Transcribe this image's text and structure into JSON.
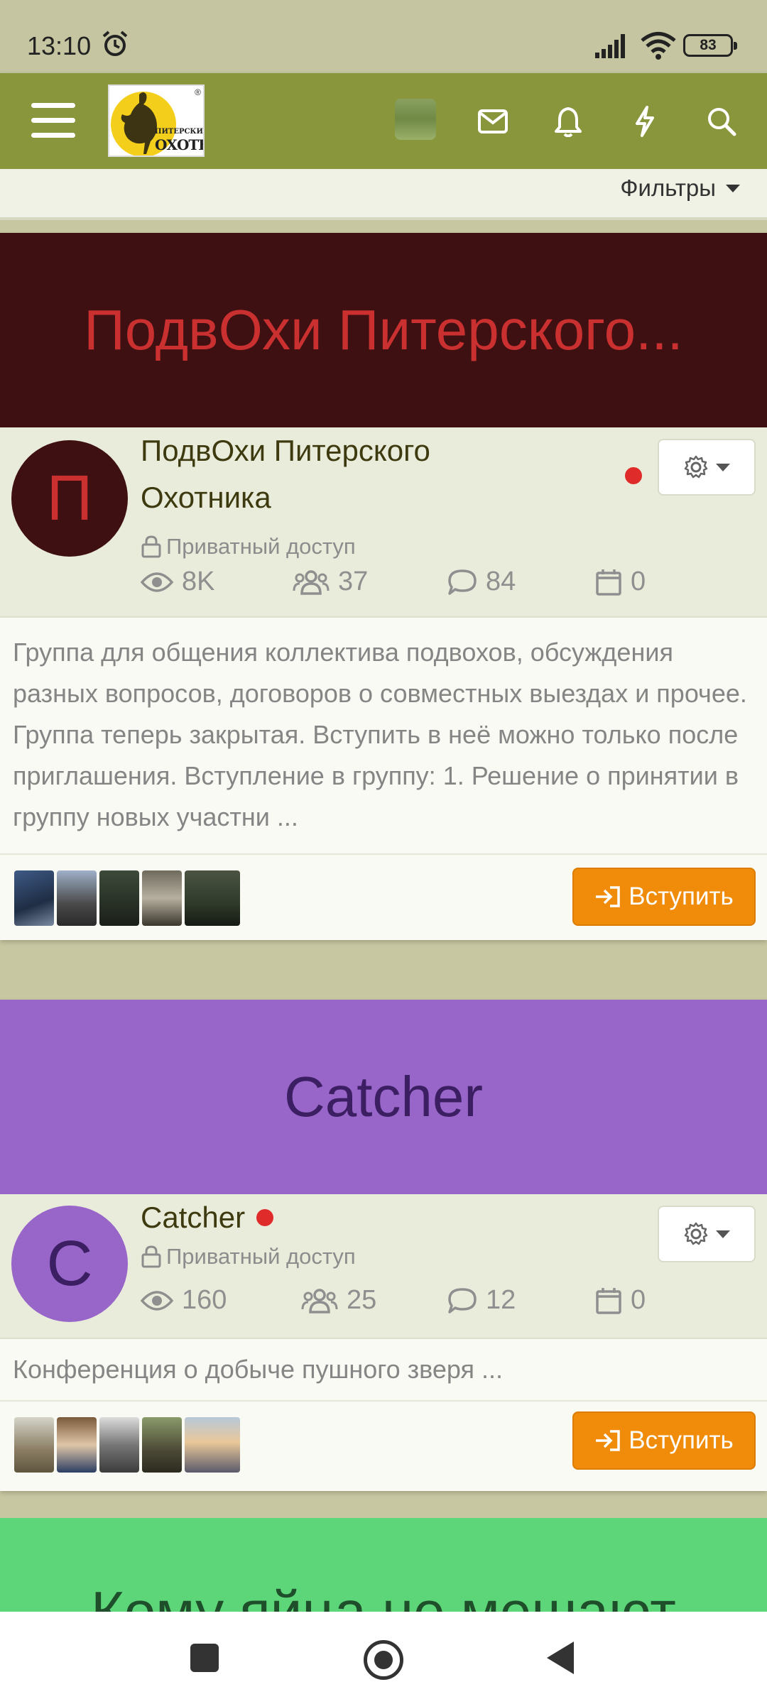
{
  "status_bar": {
    "time": "13:10",
    "battery": "83"
  },
  "header": {
    "logo_text_top": "ПИТЕРСКИЙ",
    "logo_text_main": "ОХОТНИК",
    "logo_reg": "®"
  },
  "filters": {
    "label": "Фильтры"
  },
  "groups": [
    {
      "banner_title": "ПодвОхи Питерского...",
      "avatar_letter": "П",
      "name_line1": "ПодвОхи Питерского",
      "name_line2": "Охотника",
      "privacy": "Приватный доступ",
      "views": "8K",
      "members": "37",
      "comments": "84",
      "events": "0",
      "description": "Группа для общения коллектива подвохов, обсуждения разных вопросов, договоров о совместных выездах и прочее. Группа теперь закрытая. Вступить в неё можно только после приглашения. Вступление в группу: 1. Решение о принятии в группу новых участни ...",
      "join_label": "Вступить",
      "colors": {
        "banner_bg": "#3e1012",
        "banner_text": "#c9302f",
        "avatar_bg": "#3e1012",
        "avatar_text": "#c9302f"
      }
    },
    {
      "banner_title": "Catcher",
      "avatar_letter": "C",
      "name_line1": "Catcher",
      "privacy": "Приватный доступ",
      "views": "160",
      "members": "25",
      "comments": "12",
      "events": "0",
      "description": "Конференция о добыче пушного зверя ...",
      "join_label": "Вступить",
      "colors": {
        "banner_bg": "#9866c9",
        "banner_text": "#3c1e63",
        "avatar_bg": "#9866c9",
        "avatar_text": "#3c1e63"
      }
    }
  ],
  "partial_banner": {
    "title": "Кому яйца не мешают"
  }
}
